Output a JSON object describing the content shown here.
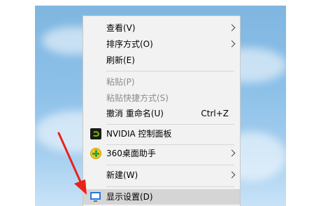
{
  "context_menu": {
    "items": [
      {
        "label": "查看(V)",
        "submenu": true
      },
      {
        "label": "排序方式(O)",
        "submenu": true
      },
      {
        "label": "刷新(E)"
      },
      {
        "label": "粘贴(P)",
        "disabled": true
      },
      {
        "label": "粘贴快捷方式(S)",
        "disabled": true
      },
      {
        "label": "撤消 重命名(U)",
        "shortcut": "Ctrl+Z"
      },
      {
        "label": "NVIDIA 控制面板",
        "icon": "nvidia-icon"
      },
      {
        "label": "360桌面助手",
        "icon": "360-desktop-icon",
        "submenu": true
      },
      {
        "label": "新建(W)",
        "submenu": true
      },
      {
        "label": "显示设置(D)",
        "icon": "monitor-icon",
        "highlighted": true
      }
    ]
  },
  "colors": {
    "menu_background": "#f2f2f2",
    "highlight": "#d5d5d5",
    "disabled_text": "#8c8c8c",
    "annotation_arrow": "#e8231b"
  }
}
